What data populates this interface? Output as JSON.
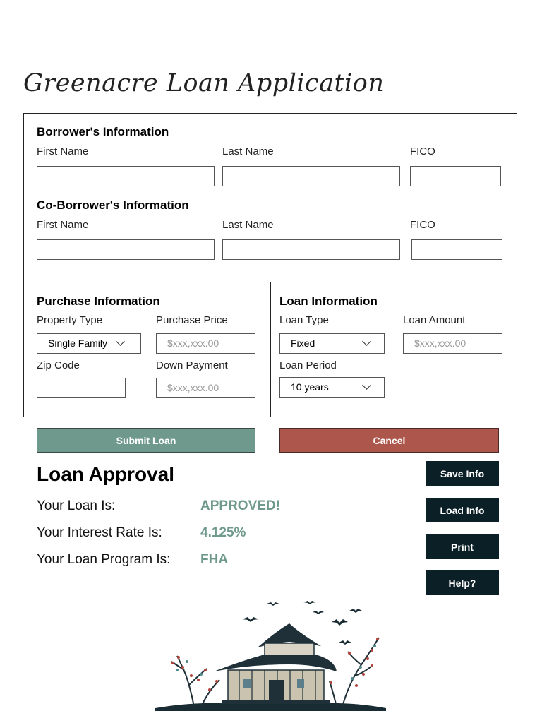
{
  "app": {
    "title": "Greenacre Loan Application"
  },
  "borrower": {
    "heading": "Borrower's Information",
    "first_name_label": "First Name",
    "last_name_label": "Last Name",
    "fico_label": "FICO",
    "first_name": "",
    "last_name": "",
    "fico": ""
  },
  "coborrower": {
    "heading": "Co-Borrower's Information",
    "first_name_label": "First Name",
    "last_name_label": "Last Name",
    "fico_label": "FICO",
    "first_name": "",
    "last_name": "",
    "fico": ""
  },
  "purchase": {
    "heading": "Purchase Information",
    "property_type_label": "Property Type",
    "property_type_value": "Single Family",
    "purchase_price_label": "Purchase Price",
    "purchase_price_placeholder": "$xxx,xxx.00",
    "zip_code_label": "Zip Code",
    "zip_code": "",
    "down_payment_label": "Down Payment",
    "down_payment_placeholder": "$xxx,xxx.00"
  },
  "loan": {
    "heading": "Loan Information",
    "loan_type_label": "Loan Type",
    "loan_type_value": "Fixed",
    "loan_amount_label": "Loan Amount",
    "loan_amount_placeholder": "$xxx,xxx.00",
    "loan_period_label": "Loan Period",
    "loan_period_value": "10 years"
  },
  "actions": {
    "submit_label": "Submit Loan",
    "cancel_label": "Cancel",
    "save_label": "Save Info",
    "load_label": "Load Info",
    "print_label": "Print",
    "help_label": "Help?"
  },
  "approval": {
    "heading": "Loan Approval",
    "status_label": "Your Loan Is:",
    "status_value": "APPROVED!",
    "rate_label": "Your Interest Rate Is:",
    "rate_value": "4.125%",
    "program_label": "Your Loan Program Is:",
    "program_value": "FHA"
  },
  "colors": {
    "accent_green": "#6f998c",
    "cancel_red": "#ad574c",
    "dark_button": "#0b1f27"
  },
  "icons": {
    "combo_arrow": "chevron-down-icon",
    "illustration": "pagoda-house-illustration"
  }
}
